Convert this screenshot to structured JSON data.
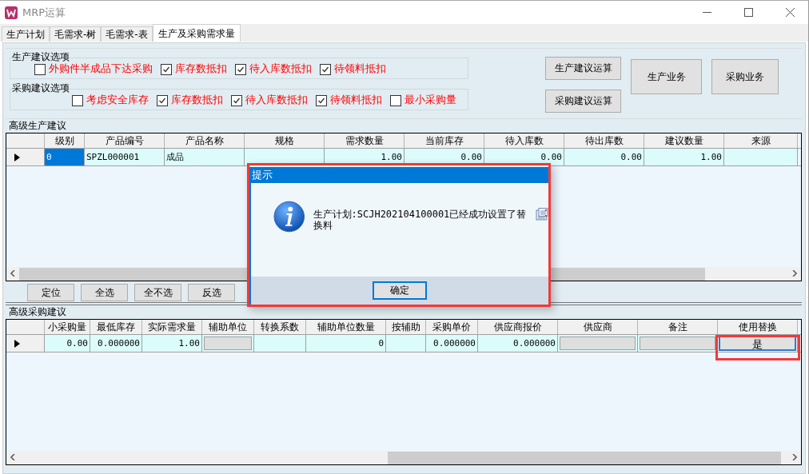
{
  "window": {
    "title": "MRP运算"
  },
  "tabs": [
    {
      "label": "生产计划",
      "selected": false
    },
    {
      "label": "毛需求-树",
      "selected": false
    },
    {
      "label": "毛需求-表",
      "selected": false
    },
    {
      "label": "生产及采购需求量",
      "selected": true
    }
  ],
  "option_groups": [
    {
      "title": "生产建议选项",
      "options": [
        {
          "label": "外购件半成品下达采购",
          "checked": false
        },
        {
          "label": "库存数抵扣",
          "checked": true
        },
        {
          "label": "待入库数抵扣",
          "checked": true
        },
        {
          "label": "待领料抵扣",
          "checked": true
        }
      ]
    },
    {
      "title": "采购建议选项",
      "options": [
        {
          "label": "考虑安全库存",
          "checked": false
        },
        {
          "label": "库存数抵扣",
          "checked": true
        },
        {
          "label": "待入库数抵扣",
          "checked": true
        },
        {
          "label": "待领料抵扣",
          "checked": true
        },
        {
          "label": "最小采购量",
          "checked": false
        }
      ]
    }
  ],
  "action_buttons": [
    {
      "label": "生产建议运算",
      "kind": "stacked"
    },
    {
      "label": "采购建议运算",
      "kind": "stacked"
    },
    {
      "label": "生产业务",
      "kind": "large"
    },
    {
      "label": "采购业务",
      "kind": "large"
    }
  ],
  "production_suggestions": {
    "title": "高级生产建议",
    "columns": [
      "级别",
      "产品编号",
      "产品名称",
      "规格",
      "需求数量",
      "当前库存",
      "待入库数",
      "待出库数",
      "建议数量",
      "来源"
    ],
    "rows": [
      {
        "current": true,
        "cells": [
          {
            "kind": "text",
            "text": "0",
            "selected": true
          },
          {
            "kind": "text",
            "text": "SPZL000001",
            "selected": false
          },
          {
            "kind": "text",
            "text": "成品",
            "selected": false
          },
          {
            "kind": "text",
            "selected": false
          },
          {
            "kind": "number",
            "text": "1.00",
            "selected": false
          },
          {
            "kind": "number",
            "text": "0.00",
            "selected": false
          },
          {
            "kind": "number",
            "text": "0.00",
            "selected": false
          },
          {
            "kind": "number",
            "text": "0.00",
            "selected": false
          },
          {
            "kind": "number",
            "text": "1.00",
            "selected": false
          },
          {
            "kind": "text",
            "selected": false
          }
        ]
      }
    ]
  },
  "grid_buttons": [
    "定位",
    "全选",
    "全不选",
    "反选"
  ],
  "purchase_suggestions": {
    "title": "高级采购建议",
    "columns": [
      "小采购量",
      "最低库存",
      "实际需求量",
      "辅助单位",
      "转换系数",
      "辅助单位数量",
      "按辅助",
      "采购单价",
      "供应商报价",
      "供应商",
      "备注",
      "使用替换"
    ],
    "rows": [
      {
        "current": true,
        "cells": [
          {
            "kind": "number",
            "text": "0.00",
            "selected": false
          },
          {
            "kind": "number",
            "text": "0.000000",
            "selected": false
          },
          {
            "kind": "number",
            "text": "1.00",
            "selected": false
          },
          {
            "kind": "combo",
            "selected": false
          },
          {
            "kind": "text",
            "selected": false
          },
          {
            "kind": "number",
            "text": "0",
            "selected": false
          },
          {
            "kind": "text",
            "selected": false
          },
          {
            "kind": "number",
            "text": "0.000000",
            "selected": false
          },
          {
            "kind": "number",
            "text": "0.000000",
            "selected": false
          },
          {
            "kind": "combo",
            "selected": false
          },
          {
            "kind": "combo",
            "selected": false
          },
          {
            "kind": "button",
            "text": "是",
            "selected": true
          }
        ]
      }
    ]
  },
  "dialog": {
    "title": "提示",
    "message": "生产计划:SCJH202104100001已经成功设置了替换料",
    "button": "确定"
  }
}
